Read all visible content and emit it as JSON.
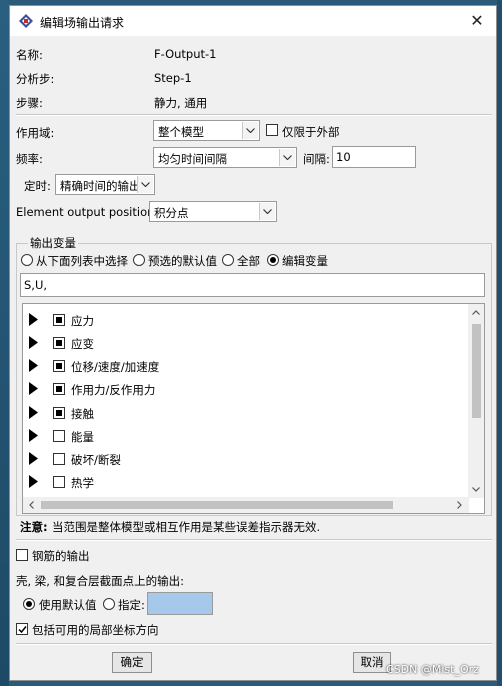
{
  "title": "编辑场输出请求",
  "close_glyph": "✕",
  "info": [
    {
      "label": "名称:",
      "value": "F-Output-1"
    },
    {
      "label": "分析步:",
      "value": "Step-1"
    },
    {
      "label": "步骤:",
      "value": "静力, 通用"
    }
  ],
  "domain": {
    "label": "作用域:",
    "value": "整个模型",
    "exterior_label": "仅限于外部"
  },
  "frequency": {
    "label": "频率:",
    "value": "均匀时间间隔",
    "interval_label": "间隔:",
    "interval_value": "10"
  },
  "timing": {
    "label": "定时:",
    "value": "精确时间的输出"
  },
  "element_output": {
    "label": "Element output position:",
    "value": "积分点"
  },
  "output_vars": {
    "group_title": "输出变量",
    "options": [
      "从下面列表中选择",
      "预选的默认值",
      "全部",
      "编辑变量"
    ],
    "selected": "编辑变量",
    "text": "S,U,",
    "tree": [
      {
        "label": "应力",
        "state": "partial"
      },
      {
        "label": "应变",
        "state": "partial"
      },
      {
        "label": "位移/速度/加速度",
        "state": "partial"
      },
      {
        "label": "作用力/反作用力",
        "state": "partial"
      },
      {
        "label": "接触",
        "state": "partial"
      },
      {
        "label": "能量",
        "state": "unchecked"
      },
      {
        "label": "破坏/断裂",
        "state": "unchecked"
      },
      {
        "label": "热学",
        "state": "unchecked"
      }
    ]
  },
  "note": {
    "prefix": "注意:",
    "text": "当范围是整体模型或相互作用是某些误差指示器无效."
  },
  "rebar": {
    "label": "钢筋的输出",
    "checked": false
  },
  "section_points": {
    "label": "壳, 梁, 和复合层截面点上的输出:",
    "options": [
      "使用默认值",
      "指定:"
    ],
    "selected": "使用默认值"
  },
  "local_coords": {
    "label": "包括可用的局部坐标方向",
    "checked": true
  },
  "buttons": {
    "ok": "确定",
    "cancel": "取消"
  },
  "watermark": "CSDN @Mist_Orz",
  "colors": {
    "accent_field": "#a6c8ea",
    "dialog_bg": "#f0f0f0"
  }
}
